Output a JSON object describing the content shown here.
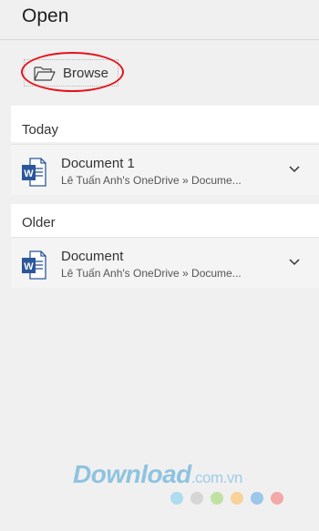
{
  "header": {
    "title": "Open"
  },
  "browse": {
    "label": "Browse",
    "icon": "folder-open-icon"
  },
  "annotation": {
    "color": "#e4141b"
  },
  "sections": [
    {
      "label": "Today",
      "items": [
        {
          "name": "Document 1",
          "path": "Lê Tuấn Anh's OneDrive » Docume...",
          "icon": "word-icon"
        }
      ]
    },
    {
      "label": "Older",
      "items": [
        {
          "name": "Document",
          "path": "Lê Tuấn Anh's OneDrive » Docume...",
          "icon": "word-icon"
        }
      ]
    }
  ],
  "watermark": {
    "brand": "Download",
    "domain": ".com.vn",
    "dot_colors": [
      "#aedcf0",
      "#d6d6d6",
      "#bfe2a2",
      "#f7d29a",
      "#9cc6ea",
      "#f3a9a9"
    ]
  },
  "colors": {
    "word_blue": "#2b579a",
    "background": "#f0f0f0"
  }
}
